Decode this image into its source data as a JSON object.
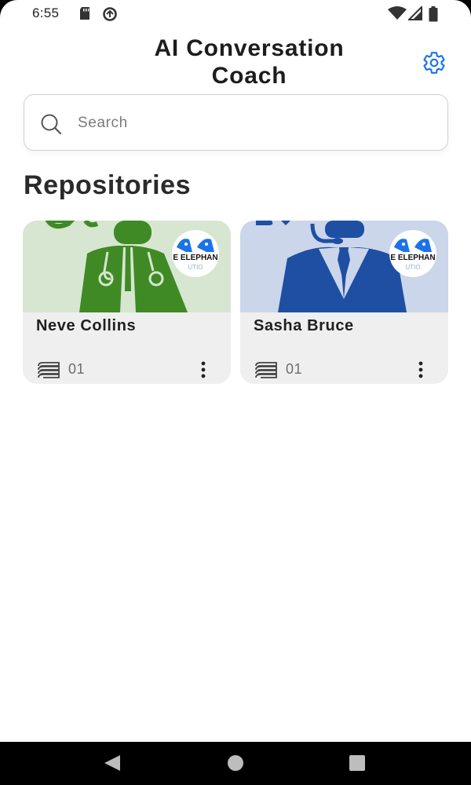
{
  "status_bar": {
    "time": "6:55",
    "left_icons": [
      "sd-card-icon",
      "data-saver-icon"
    ],
    "right_icons": [
      "wifi-icon",
      "signal-icon",
      "battery-icon"
    ]
  },
  "header": {
    "title": "AI Conversation Coach",
    "settings_icon": "gear-icon"
  },
  "search": {
    "placeholder": "Search",
    "value": ""
  },
  "section": {
    "title": "Repositories"
  },
  "cards": [
    {
      "name": "Neve Collins",
      "count": "01",
      "image_color": "#d6e6d0",
      "figure_color": "#3f8a25",
      "logo_text": "E ELEPHAN"
    },
    {
      "name": "Sasha Bruce",
      "count": "01",
      "image_color": "#cbd6ea",
      "figure_color": "#1f4fa3",
      "logo_text": "E ELEPHAN"
    }
  ],
  "colors": {
    "accent": "#1a73e8",
    "card_bg": "#efefef"
  },
  "nav": {
    "back": "back-icon",
    "home": "home-icon",
    "recents": "recents-icon"
  }
}
